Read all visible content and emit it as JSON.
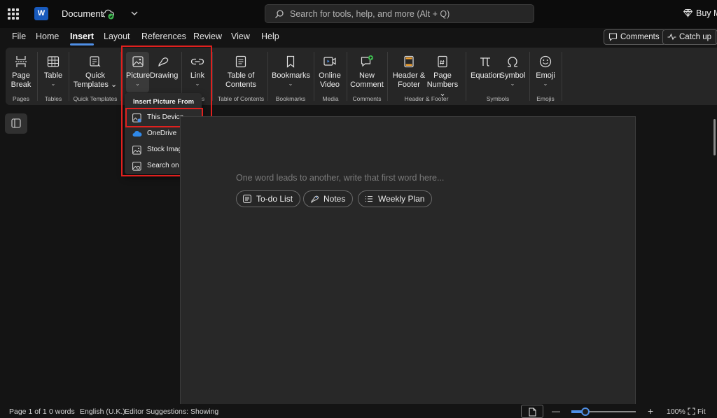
{
  "titlebar": {
    "doc_title": "Document",
    "search_placeholder": "Search for tools, help, and more (Alt + Q)",
    "buy_label": "Buy M",
    "app_badge": "W"
  },
  "menu": {
    "tabs": [
      "File",
      "Home",
      "Insert",
      "Layout",
      "References",
      "Review",
      "View",
      "Help"
    ],
    "active_tab": "Insert",
    "comments_label": "Comments",
    "catchup_label": "Catch up"
  },
  "ribbon": {
    "buttons": [
      {
        "label1": "Page",
        "label2": "Break",
        "chev": ""
      },
      {
        "label1": "Table",
        "label2": "",
        "chev": "⌄"
      },
      {
        "label1": "Quick",
        "label2": "Templates ⌄",
        "chev": ""
      },
      {
        "label1": "Picture",
        "label2": "",
        "chev": "⌄"
      },
      {
        "label1": "Drawing",
        "label2": "",
        "chev": ""
      },
      {
        "label1": "Link",
        "label2": "",
        "chev": "⌄"
      },
      {
        "label1": "Table of",
        "label2": "Contents",
        "chev": ""
      },
      {
        "label1": "Bookmarks",
        "label2": "",
        "chev": "⌄"
      },
      {
        "label1": "Online",
        "label2": "Video",
        "chev": ""
      },
      {
        "label1": "New",
        "label2": "Comment",
        "chev": ""
      },
      {
        "label1": "Header &",
        "label2": "Footer",
        "chev": ""
      },
      {
        "label1": "Page",
        "label2": "Numbers ⌄",
        "chev": ""
      },
      {
        "label1": "Equation",
        "label2": "",
        "chev": "⌄"
      },
      {
        "label1": "Symbol",
        "label2": "",
        "chev": "⌄"
      },
      {
        "label1": "Emoji",
        "label2": "",
        "chev": "⌄"
      }
    ],
    "groups": [
      "Pages",
      "Tables",
      "Quick Templates",
      "s",
      "Table of Contents",
      "Bookmarks",
      "Media",
      "Comments",
      "Header & Footer",
      "Symbols",
      "Emojis"
    ]
  },
  "dropdown": {
    "header": "Insert Picture From",
    "items": [
      "This Device",
      "OneDrive",
      "Stock Images",
      "Search on Web"
    ]
  },
  "page": {
    "placeholder": "One word leads to another, write that first word here...",
    "chips": [
      "To-do List",
      "Notes",
      "Weekly Plan"
    ]
  },
  "status": {
    "page": "Page 1 of 1",
    "words": "0 words",
    "language": "English (U.K.)",
    "suggestions": "Editor Suggestions: Showing",
    "zoom_minus": "—",
    "zoom_plus": "+",
    "zoom": "100%",
    "fit": "Fit",
    "zoom_level": 0.22
  },
  "colors": {
    "accent": "#4f8fe6",
    "highlight_box": "#e0201e",
    "word_brand": "#185abd",
    "saved_green": "#3fb950"
  }
}
